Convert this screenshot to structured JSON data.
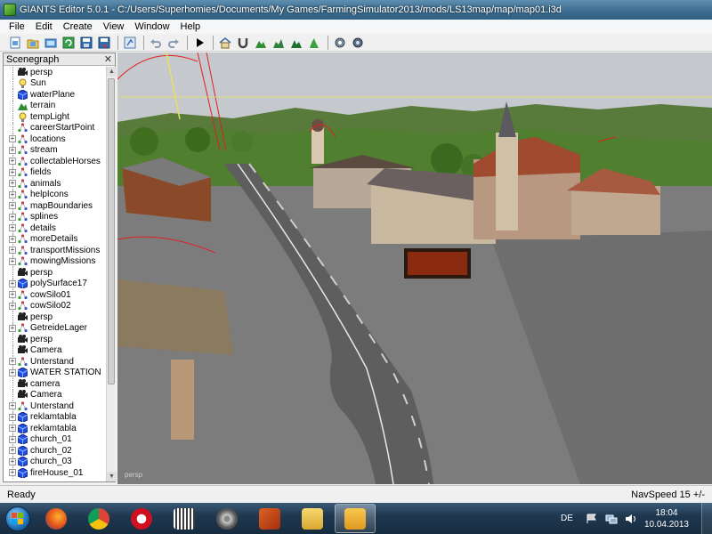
{
  "window": {
    "title": "GIANTS Editor 5.0.1 - C:/Users/Superhomies/Documents/My Games/FarmingSimulator2013/mods/LS13map/map/map01.i3d"
  },
  "menu": {
    "items": [
      {
        "label": "File"
      },
      {
        "label": "Edit"
      },
      {
        "label": "Create"
      },
      {
        "label": "View"
      },
      {
        "label": "Window"
      },
      {
        "label": "Help"
      }
    ]
  },
  "toolbar": {
    "buttons": [
      "new-file",
      "open-file",
      "open-folder",
      "refresh",
      "save",
      "save-as",
      "import",
      "undo",
      "redo",
      "play",
      "home",
      "magnet",
      "terrain-paint",
      "terrain-raise",
      "terrain-smooth",
      "foliage",
      "settings",
      "settings-alt"
    ]
  },
  "scenegraph": {
    "title": "Scenegraph",
    "close_label": "✕",
    "nodes": [
      {
        "label": "persp",
        "icon": "camera",
        "expandable": false
      },
      {
        "label": "Sun",
        "icon": "light",
        "expandable": false
      },
      {
        "label": "waterPlane",
        "icon": "cube",
        "expandable": false
      },
      {
        "label": "terrain",
        "icon": "terrain",
        "expandable": false
      },
      {
        "label": "tempLight",
        "icon": "light",
        "expandable": false
      },
      {
        "label": "careerStartPoint",
        "icon": "transform",
        "expandable": false
      },
      {
        "label": "locations",
        "icon": "transform",
        "expandable": true
      },
      {
        "label": "stream",
        "icon": "transform",
        "expandable": true
      },
      {
        "label": "collectableHorses",
        "icon": "transform",
        "expandable": true
      },
      {
        "label": "fields",
        "icon": "transform",
        "expandable": true
      },
      {
        "label": "animals",
        "icon": "transform",
        "expandable": true
      },
      {
        "label": "helpIcons",
        "icon": "transform",
        "expandable": true
      },
      {
        "label": "mapBoundaries",
        "icon": "transform",
        "expandable": true
      },
      {
        "label": "splines",
        "icon": "transform",
        "expandable": true
      },
      {
        "label": "details",
        "icon": "transform",
        "expandable": true
      },
      {
        "label": "moreDetails",
        "icon": "transform",
        "expandable": true
      },
      {
        "label": "transportMissions",
        "icon": "transform",
        "expandable": true
      },
      {
        "label": "mowingMissions",
        "icon": "transform",
        "expandable": true
      },
      {
        "label": "persp",
        "icon": "camera",
        "expandable": false
      },
      {
        "label": "polySurface17",
        "icon": "cube",
        "expandable": true
      },
      {
        "label": "cowSilo01",
        "icon": "transform",
        "expandable": true
      },
      {
        "label": "cowSilo02",
        "icon": "transform",
        "expandable": true
      },
      {
        "label": "persp",
        "icon": "camera",
        "expandable": false
      },
      {
        "label": "GetreideLager",
        "icon": "transform",
        "expandable": true
      },
      {
        "label": "persp",
        "icon": "camera",
        "expandable": false
      },
      {
        "label": "Camera",
        "icon": "camera",
        "expandable": false
      },
      {
        "label": "Unterstand",
        "icon": "transform",
        "expandable": true
      },
      {
        "label": "WATER STATION",
        "icon": "cube",
        "expandable": true
      },
      {
        "label": "camera",
        "icon": "camera",
        "expandable": false
      },
      {
        "label": "Camera",
        "icon": "camera",
        "expandable": false
      },
      {
        "label": "Unterstand",
        "icon": "transform",
        "expandable": true
      },
      {
        "label": "reklamtabla",
        "icon": "cube",
        "expandable": true
      },
      {
        "label": "reklamtabla",
        "icon": "cube",
        "expandable": true
      },
      {
        "label": "church_01",
        "icon": "cube",
        "expandable": true
      },
      {
        "label": "church_02",
        "icon": "cube",
        "expandable": true
      },
      {
        "label": "church_03",
        "icon": "cube",
        "expandable": true
      },
      {
        "label": "fireHouse_01",
        "icon": "cube",
        "expandable": true
      }
    ]
  },
  "viewport": {
    "camera_label": "persp"
  },
  "status": {
    "left": "Ready",
    "right": "NavSpeed 15 +/-"
  },
  "taskbar": {
    "apps": [
      {
        "name": "firefox",
        "active": false
      },
      {
        "name": "chrome",
        "active": false
      },
      {
        "name": "opera",
        "active": false
      },
      {
        "name": "audio-editor",
        "active": false
      },
      {
        "name": "media-player",
        "active": false
      },
      {
        "name": "video-tool",
        "active": false
      },
      {
        "name": "file-explorer",
        "active": false
      },
      {
        "name": "giants-editor",
        "active": true
      }
    ],
    "language": "DE",
    "time": "18:04",
    "date": "10.04.2013"
  },
  "colors": {
    "sky": "#c5c8cc",
    "hills": "#4f7f2f",
    "road": "#5a5a5a",
    "ground": "#7a7a7a",
    "gizmo_red": "#e02020",
    "gizmo_yellow": "#e8e060",
    "titlebar": "#3f6f92"
  }
}
